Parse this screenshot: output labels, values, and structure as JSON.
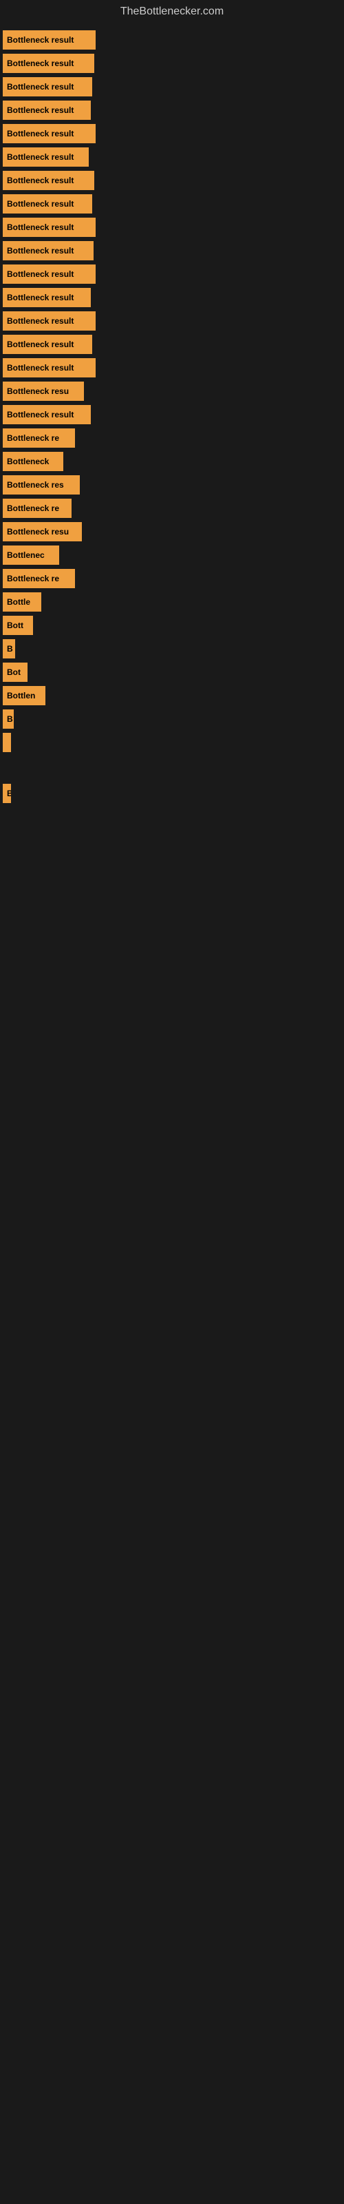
{
  "header": {
    "title": "TheBottlenecker.com"
  },
  "bars": [
    {
      "label": "Bottleneck result",
      "width": 135
    },
    {
      "label": "Bottleneck result",
      "width": 133
    },
    {
      "label": "Bottleneck result",
      "width": 130
    },
    {
      "label": "Bottleneck result",
      "width": 128
    },
    {
      "label": "Bottleneck result",
      "width": 135
    },
    {
      "label": "Bottleneck result",
      "width": 125
    },
    {
      "label": "Bottleneck result",
      "width": 133
    },
    {
      "label": "Bottleneck result",
      "width": 130
    },
    {
      "label": "Bottleneck result",
      "width": 135
    },
    {
      "label": "Bottleneck result",
      "width": 132
    },
    {
      "label": "Bottleneck result",
      "width": 135
    },
    {
      "label": "Bottleneck result",
      "width": 128
    },
    {
      "label": "Bottleneck result",
      "width": 135
    },
    {
      "label": "Bottleneck result",
      "width": 130
    },
    {
      "label": "Bottleneck result",
      "width": 135
    },
    {
      "label": "Bottleneck resu",
      "width": 118
    },
    {
      "label": "Bottleneck result",
      "width": 128
    },
    {
      "label": "Bottleneck re",
      "width": 105
    },
    {
      "label": "Bottleneck",
      "width": 88
    },
    {
      "label": "Bottleneck res",
      "width": 112
    },
    {
      "label": "Bottleneck re",
      "width": 100
    },
    {
      "label": "Bottleneck resu",
      "width": 115
    },
    {
      "label": "Bottlenec",
      "width": 82
    },
    {
      "label": "Bottleneck re",
      "width": 105
    },
    {
      "label": "Bottle",
      "width": 56
    },
    {
      "label": "Bott",
      "width": 44
    },
    {
      "label": "B",
      "width": 18
    },
    {
      "label": "Bot",
      "width": 36
    },
    {
      "label": "Bottlen",
      "width": 62
    },
    {
      "label": "B",
      "width": 16
    },
    {
      "label": "",
      "width": 6
    },
    {
      "label": "",
      "width": 0
    },
    {
      "label": "B",
      "width": 12
    },
    {
      "label": "",
      "width": 0
    },
    {
      "label": "",
      "width": 0
    },
    {
      "label": "",
      "width": 0
    }
  ]
}
